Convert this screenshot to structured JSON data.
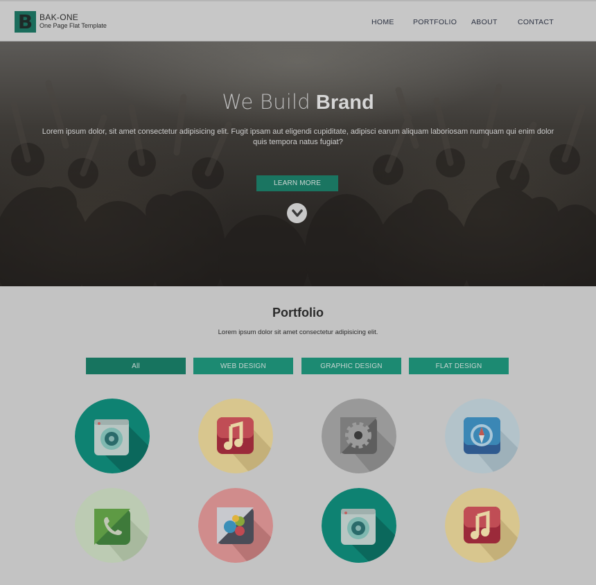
{
  "brand": {
    "logo_letter": "B",
    "name": "BAK-ONE",
    "tagline": "One Page Flat Template"
  },
  "nav": {
    "items": [
      {
        "label": "HOME"
      },
      {
        "label": "PORTFOLIO"
      },
      {
        "label": "ABOUT"
      },
      {
        "label": "CONTACT"
      }
    ]
  },
  "hero": {
    "title_light": "We Build",
    "title_bold": "Brand",
    "text": "Lorem ipsum dolor, sit amet consectetur adipisicing elit. Fugit ipsam aut eligendi cupiditate, adipisci earum aliquam laboriosam numquam qui enim dolor quis tempora natus fugiat?",
    "button_label": "LEARN MORE",
    "scroll_icon": "chevron-down-icon"
  },
  "portfolio": {
    "title": "Portfolio",
    "subtitle": "Lorem ipsum dolor sit amet consectetur adipisicing elit.",
    "filters": [
      {
        "label": "All",
        "active": true
      },
      {
        "label": "WEB DESIGN",
        "active": false
      },
      {
        "label": "GRAPHIC DESIGN",
        "active": false
      },
      {
        "label": "FLAT DESIGN",
        "active": false
      }
    ],
    "items": [
      {
        "icon": "camera-icon",
        "bg": "#0e8272"
      },
      {
        "icon": "music-icon",
        "bg": "#d8c68e"
      },
      {
        "icon": "settings-icon",
        "bg": "#999999"
      },
      {
        "icon": "compass-icon",
        "bg": "#b3c3ca"
      },
      {
        "icon": "phone-icon",
        "bg": "#bccbb3"
      },
      {
        "icon": "chat-icon",
        "bg": "#d08c8c"
      },
      {
        "icon": "camera-icon",
        "bg": "#0e8272"
      },
      {
        "icon": "music-icon",
        "bg": "#d8c68e"
      }
    ]
  },
  "colors": {
    "accent": "#1c8a72",
    "accent_dark": "#17745f",
    "page_bg": "#c3c3c3"
  }
}
